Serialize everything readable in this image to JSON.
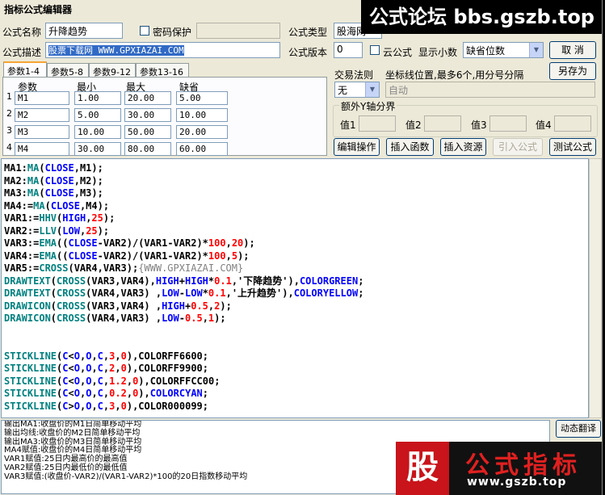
{
  "window": {
    "title": "指标公式编辑器"
  },
  "header": {
    "name_label": "公式名称",
    "name_value": "升降趋势",
    "password_label": "密码保护",
    "type_label": "公式类型",
    "type_value": "股海网",
    "desc_label": "公式描述",
    "desc_value": "股票下载网 WWW.GPXIAZAI.COM",
    "version_label": "公式版本",
    "version_value": "0",
    "cloud_label": "云公式",
    "decimal_label": "显示小数",
    "decimal_value": "缺省位数",
    "cancel_label": "取 消",
    "saveas_label": "另存为"
  },
  "tabs": [
    "参数1-4",
    "参数5-8",
    "参数9-12",
    "参数13-16"
  ],
  "params": {
    "headers": [
      "参数",
      "最小",
      "最大",
      "缺省"
    ],
    "rows": [
      {
        "idx": "1",
        "name": "M1",
        "min": "1.00",
        "max": "20.00",
        "def": "5.00"
      },
      {
        "idx": "2",
        "name": "M2",
        "min": "5.00",
        "max": "30.00",
        "def": "10.00"
      },
      {
        "idx": "3",
        "name": "M3",
        "min": "10.00",
        "max": "50.00",
        "def": "20.00"
      },
      {
        "idx": "4",
        "name": "M4",
        "min": "30.00",
        "max": "80.00",
        "def": "60.00"
      }
    ]
  },
  "trade": {
    "rule_label": "交易法则",
    "rule_value": "无",
    "coord_label": "坐标线位置,最多6个,用分号分隔",
    "coord_value": "自动",
    "yaxis_label": "额外Y轴分界",
    "v1": "值1",
    "v2": "值2",
    "v3": "值3",
    "v4": "值4"
  },
  "toolbar": {
    "edit": "编辑操作",
    "insert_func": "插入函数",
    "insert_res": "插入资源",
    "import": "引入公式",
    "test": "测试公式"
  },
  "code": {
    "lines": [
      [
        [
          "MA1:",
          "op"
        ],
        [
          "MA",
          "fn"
        ],
        [
          "(",
          "op"
        ],
        [
          "CLOSE",
          "kw"
        ],
        [
          ",M1);",
          "op"
        ]
      ],
      [
        [
          "MA2:",
          "op"
        ],
        [
          "MA",
          "fn"
        ],
        [
          "(",
          "op"
        ],
        [
          "CLOSE",
          "kw"
        ],
        [
          ",M2);",
          "op"
        ]
      ],
      [
        [
          "MA3:",
          "op"
        ],
        [
          "MA",
          "fn"
        ],
        [
          "(",
          "op"
        ],
        [
          "CLOSE",
          "kw"
        ],
        [
          ",M3);",
          "op"
        ]
      ],
      [
        [
          "MA4:=",
          "op"
        ],
        [
          "MA",
          "fn"
        ],
        [
          "(",
          "op"
        ],
        [
          "CLOSE",
          "kw"
        ],
        [
          ",M4);",
          "op"
        ]
      ],
      [
        [
          "VAR1:=",
          "op"
        ],
        [
          "HHV",
          "fn"
        ],
        [
          "(",
          "op"
        ],
        [
          "HIGH",
          "kw"
        ],
        [
          ",",
          "op"
        ],
        [
          "25",
          "num"
        ],
        [
          ");",
          "op"
        ]
      ],
      [
        [
          "VAR2:=",
          "op"
        ],
        [
          "LLV",
          "fn"
        ],
        [
          "(",
          "op"
        ],
        [
          "LOW",
          "kw"
        ],
        [
          ",",
          "op"
        ],
        [
          "25",
          "num"
        ],
        [
          ");",
          "op"
        ]
      ],
      [
        [
          "VAR3:=",
          "op"
        ],
        [
          "EMA",
          "fn"
        ],
        [
          "((",
          "op"
        ],
        [
          "CLOSE",
          "kw"
        ],
        [
          "-VAR2)/(VAR1-VAR2)*",
          "op"
        ],
        [
          "100",
          "num"
        ],
        [
          ",",
          "op"
        ],
        [
          "20",
          "num"
        ],
        [
          ");",
          "op"
        ]
      ],
      [
        [
          "VAR4:=",
          "op"
        ],
        [
          "EMA",
          "fn"
        ],
        [
          "((",
          "op"
        ],
        [
          "CLOSE",
          "kw"
        ],
        [
          "-VAR2)/(VAR1-VAR2)*",
          "op"
        ],
        [
          "100",
          "num"
        ],
        [
          ",",
          "op"
        ],
        [
          "5",
          "num"
        ],
        [
          ");",
          "op"
        ]
      ],
      [
        [
          "VAR5:=",
          "op"
        ],
        [
          "CROSS",
          "fn"
        ],
        [
          "(VAR4,VAR3);",
          "op"
        ],
        [
          "{WWW.GPXIAZAI.COM}",
          "cm"
        ]
      ],
      [
        [
          "DRAWTEXT",
          "fn"
        ],
        [
          "(",
          "op"
        ],
        [
          "CROSS",
          "fn"
        ],
        [
          "(VAR3,VAR4),",
          "op"
        ],
        [
          "HIGH",
          "kw"
        ],
        [
          "+",
          "op"
        ],
        [
          "HIGH",
          "kw"
        ],
        [
          "*",
          "op"
        ],
        [
          "0.1",
          "num"
        ],
        [
          ",'下降趋势'),",
          "op"
        ],
        [
          "COLORGREEN",
          "kw"
        ],
        [
          ";",
          "op"
        ]
      ],
      [
        [
          "DRAWTEXT",
          "fn"
        ],
        [
          "(",
          "op"
        ],
        [
          "CROSS",
          "fn"
        ],
        [
          "(VAR4,VAR3) ,",
          "op"
        ],
        [
          "LOW",
          "kw"
        ],
        [
          "-",
          "op"
        ],
        [
          "LOW",
          "kw"
        ],
        [
          "*",
          "op"
        ],
        [
          "0.1",
          "num"
        ],
        [
          ",'上升趋势'),",
          "op"
        ],
        [
          "COLORYELLOW",
          "kw"
        ],
        [
          ";",
          "op"
        ]
      ],
      [
        [
          "DRAWICON",
          "fn"
        ],
        [
          "(",
          "op"
        ],
        [
          "CROSS",
          "fn"
        ],
        [
          "(VAR3,VAR4) ,",
          "op"
        ],
        [
          "HIGH",
          "kw"
        ],
        [
          "+",
          "op"
        ],
        [
          "0.5",
          "num"
        ],
        [
          ",",
          "op"
        ],
        [
          "2",
          "num"
        ],
        [
          ");",
          "op"
        ]
      ],
      [
        [
          "DRAWICON",
          "fn"
        ],
        [
          "(",
          "op"
        ],
        [
          "CROSS",
          "fn"
        ],
        [
          "(VAR4,VAR3) ,",
          "op"
        ],
        [
          "LOW",
          "kw"
        ],
        [
          "-",
          "op"
        ],
        [
          "0.5",
          "num"
        ],
        [
          ",",
          "op"
        ],
        [
          "1",
          "num"
        ],
        [
          ");",
          "op"
        ]
      ],
      [
        [
          "",
          "op"
        ]
      ],
      [
        [
          "",
          "op"
        ]
      ],
      [
        [
          "STICKLINE",
          "fn"
        ],
        [
          "(",
          "op"
        ],
        [
          "C",
          "kw"
        ],
        [
          "<",
          "op"
        ],
        [
          "O",
          "kw"
        ],
        [
          ",",
          "op"
        ],
        [
          "O",
          "kw"
        ],
        [
          ",",
          "op"
        ],
        [
          "C",
          "kw"
        ],
        [
          ",",
          "op"
        ],
        [
          "3",
          "num"
        ],
        [
          ",",
          "op"
        ],
        [
          "0",
          "num"
        ],
        [
          "),COLORFF6600;",
          "op"
        ]
      ],
      [
        [
          "STICKLINE",
          "fn"
        ],
        [
          "(",
          "op"
        ],
        [
          "C",
          "kw"
        ],
        [
          "<",
          "op"
        ],
        [
          "O",
          "kw"
        ],
        [
          ",",
          "op"
        ],
        [
          "O",
          "kw"
        ],
        [
          ",",
          "op"
        ],
        [
          "C",
          "kw"
        ],
        [
          ",",
          "op"
        ],
        [
          "2",
          "num"
        ],
        [
          ",",
          "op"
        ],
        [
          "0",
          "num"
        ],
        [
          "),COLORFF9900;",
          "op"
        ]
      ],
      [
        [
          "STICKLINE",
          "fn"
        ],
        [
          "(",
          "op"
        ],
        [
          "C",
          "kw"
        ],
        [
          "<",
          "op"
        ],
        [
          "O",
          "kw"
        ],
        [
          ",",
          "op"
        ],
        [
          "O",
          "kw"
        ],
        [
          ",",
          "op"
        ],
        [
          "C",
          "kw"
        ],
        [
          ",",
          "op"
        ],
        [
          "1.2",
          "num"
        ],
        [
          ",",
          "op"
        ],
        [
          "0",
          "num"
        ],
        [
          "),COLORFFCC00;",
          "op"
        ]
      ],
      [
        [
          "STICKLINE",
          "fn"
        ],
        [
          "(",
          "op"
        ],
        [
          "C",
          "kw"
        ],
        [
          "<",
          "op"
        ],
        [
          "O",
          "kw"
        ],
        [
          ",",
          "op"
        ],
        [
          "O",
          "kw"
        ],
        [
          ",",
          "op"
        ],
        [
          "C",
          "kw"
        ],
        [
          ",",
          "op"
        ],
        [
          "0.2",
          "num"
        ],
        [
          ",",
          "op"
        ],
        [
          "0",
          "num"
        ],
        [
          "),",
          "op"
        ],
        [
          "COLORCYAN",
          "kw"
        ],
        [
          ";",
          "op"
        ]
      ],
      [
        [
          "STICKLINE",
          "fn"
        ],
        [
          "(",
          "op"
        ],
        [
          "C",
          "kw"
        ],
        [
          ">",
          "op"
        ],
        [
          "O",
          "kw"
        ],
        [
          ",",
          "op"
        ],
        [
          "O",
          "kw"
        ],
        [
          ",",
          "op"
        ],
        [
          "C",
          "kw"
        ],
        [
          ",",
          "op"
        ],
        [
          "3",
          "num"
        ],
        [
          ",",
          "op"
        ],
        [
          "0",
          "num"
        ],
        [
          "),COLOR000099;",
          "op"
        ]
      ]
    ]
  },
  "output": {
    "lines": [
      "输出MA1:收盘价的M1日简单移动平均",
      "输出均线:收盘价的M2日简单移动平均",
      "输出MA3:收盘价的M3日简单移动平均",
      "MA4赋值:收盘价的M4日简单移动平均",
      "VAR1赋值:25日内最高价的最高值",
      "VAR2赋值:25日内最低价的最低值",
      "VAR3赋值:(收盘价-VAR2)/(VAR1-VAR2)*100的20日指数移动平均"
    ],
    "dynamic_label": "动态翻译"
  },
  "watermark": {
    "top": "公式论坛 bbs.gszb.top",
    "logo_char": "股",
    "logo_title": "公式指标",
    "logo_url": "www.gszb.top"
  }
}
